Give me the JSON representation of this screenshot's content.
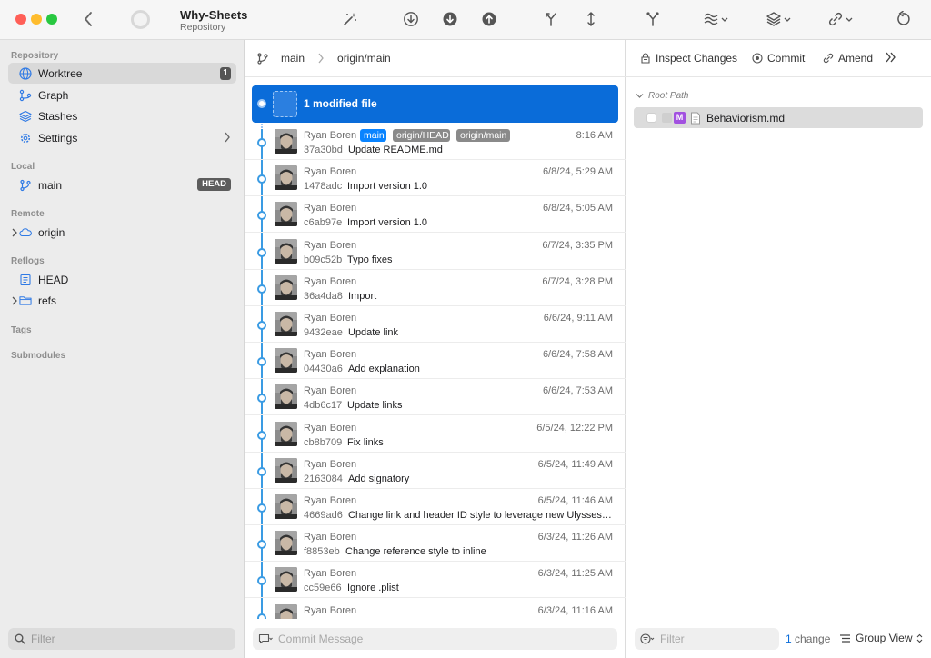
{
  "titlebar": {
    "repo_name": "Why-Sheets",
    "repo_subtitle": "Repository",
    "icons": [
      "back-chevron-icon",
      "magic-wand-icon",
      "fetch-icon",
      "pull-icon",
      "push-icon",
      "merge-icon",
      "branch-split-icon",
      "fork-icon",
      "stash-menu-icon",
      "layers-menu-icon",
      "link-menu-icon",
      "refresh-icon"
    ]
  },
  "sidebar": {
    "repository_label": "Repository",
    "repository_items": [
      {
        "label": "Worktree",
        "badge": "1",
        "icon": "globe-icon"
      },
      {
        "label": "Graph",
        "icon": "graph-icon"
      },
      {
        "label": "Stashes",
        "icon": "stack-icon"
      },
      {
        "label": "Settings",
        "icon": "gear-icon"
      }
    ],
    "local_label": "Local",
    "local_items": [
      {
        "label": "main",
        "badge": "HEAD",
        "icon": "branch-icon"
      }
    ],
    "remote_label": "Remote",
    "remote_items": [
      {
        "label": "origin",
        "icon": "cloud-icon"
      }
    ],
    "reflogs_label": "Reflogs",
    "reflogs_items": [
      {
        "label": "HEAD",
        "icon": "log-icon"
      },
      {
        "label": "refs",
        "icon": "folder-icon"
      }
    ],
    "tags_label": "Tags",
    "submodules_label": "Submodules",
    "filter_placeholder": "Filter"
  },
  "middle": {
    "branch_local": "main",
    "branch_remote": "origin/main",
    "wip_title": "1 modified file",
    "commit_message_placeholder": "Commit Message",
    "commits": [
      {
        "author": "Ryan Boren",
        "date": "8:16 AM",
        "hash": "37a30bd",
        "message": "Update README.md",
        "tags": [
          "main",
          "origin/HEAD",
          "origin/main"
        ]
      },
      {
        "author": "Ryan Boren",
        "date": "6/8/24, 5:29 AM",
        "hash": "1478adc",
        "message": "Import version 1.0"
      },
      {
        "author": "Ryan Boren",
        "date": "6/8/24, 5:05 AM",
        "hash": "c6ab97e",
        "message": "Import version 1.0"
      },
      {
        "author": "Ryan Boren",
        "date": "6/7/24, 3:35 PM",
        "hash": "b09c52b",
        "message": "Typo fixes"
      },
      {
        "author": "Ryan Boren",
        "date": "6/7/24, 3:28 PM",
        "hash": "36a4da8",
        "message": "Import"
      },
      {
        "author": "Ryan Boren",
        "date": "6/6/24, 9:11 AM",
        "hash": "9432eae",
        "message": "Update link"
      },
      {
        "author": "Ryan Boren",
        "date": "6/6/24, 7:58 AM",
        "hash": "04430a6",
        "message": "Add explanation"
      },
      {
        "author": "Ryan Boren",
        "date": "6/6/24, 7:53 AM",
        "hash": "4db6c17",
        "message": "Update links"
      },
      {
        "author": "Ryan Boren",
        "date": "6/5/24, 12:22 PM",
        "hash": "cb8b709",
        "message": "Fix links"
      },
      {
        "author": "Ryan Boren",
        "date": "6/5/24, 11:49 AM",
        "hash": "2163084",
        "message": "Add signatory"
      },
      {
        "author": "Ryan Boren",
        "date": "6/5/24, 11:46 AM",
        "hash": "4669ad6",
        "message": "Change link and header ID style to leverage new Ulyssess f..."
      },
      {
        "author": "Ryan Boren",
        "date": "6/3/24, 11:26 AM",
        "hash": "f8853eb",
        "message": "Change reference style to inline"
      },
      {
        "author": "Ryan Boren",
        "date": "6/3/24, 11:25 AM",
        "hash": "cc59e66",
        "message": "Ignore .plist"
      },
      {
        "author": "Ryan Boren",
        "date": "6/3/24, 11:16 AM",
        "hash": "",
        "message": ""
      }
    ]
  },
  "right": {
    "inspect_label": "Inspect Changes",
    "commit_label": "Commit",
    "amend_label": "Amend",
    "root_path_label": "Root Path",
    "file": {
      "status": "M",
      "name": "Behaviorism.md"
    },
    "filter_placeholder": "Filter",
    "change_count": "1",
    "change_word": "change",
    "group_view_label": "Group View"
  },
  "colors": {
    "accent": "#0a6cd9",
    "graph_line": "#3a9be3",
    "tag_main": "#0a84ff",
    "tag_remote": "#8a8a8a",
    "modified_badge": "#a251e0"
  }
}
